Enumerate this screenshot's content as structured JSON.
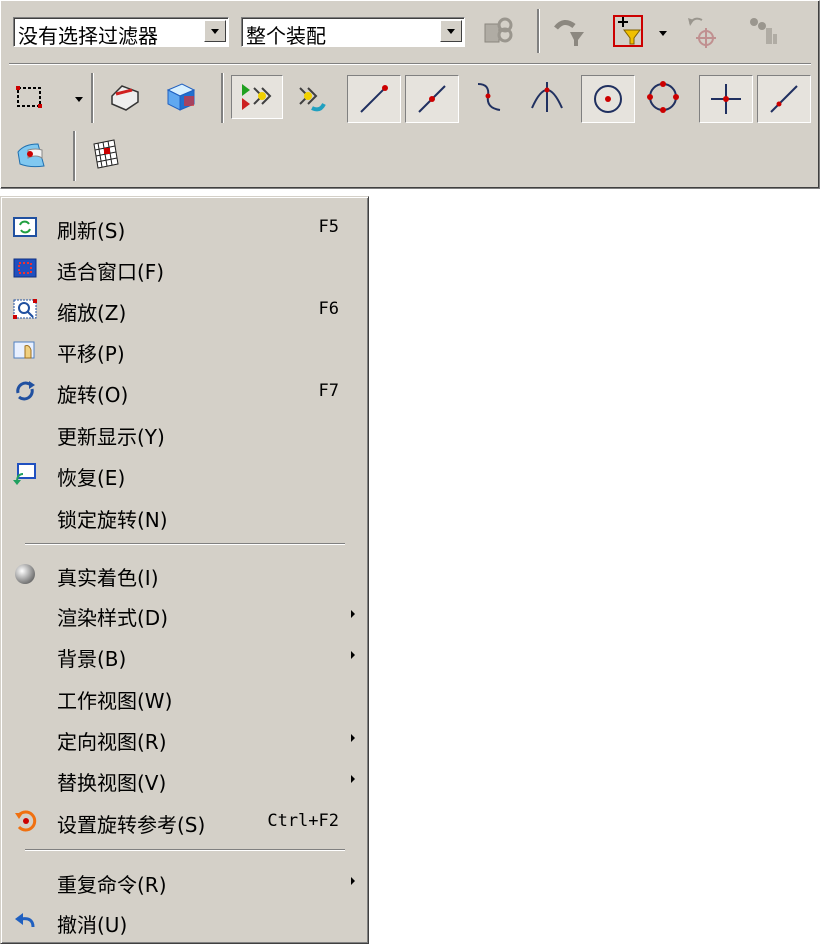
{
  "toolbar": {
    "filter_combo": {
      "value": "没有选择过滤器"
    },
    "scope_combo": {
      "value": "整个装配"
    },
    "row1_icons": [
      "assembly-constraint-icon",
      "undo-filter-icon",
      "select-filter-icon",
      "point-constructor-icon",
      "chain-icon"
    ],
    "row2_icons": [
      "rectangle-select-icon",
      "render-shade-icon",
      "cube-icon",
      "select-all-icon",
      "deselect-icon",
      "line-end-icon",
      "line-mid-icon",
      "curve-icon",
      "intersection-icon",
      "arc-center-icon",
      "quadrant-icon",
      "cross-point-icon",
      "point-on-curve-icon"
    ],
    "row3_icons": [
      "surface-icon",
      "grid-icon"
    ]
  },
  "menu": {
    "items": [
      {
        "label": "刷新(S)",
        "shortcut": "F5",
        "icon": "refresh-icon"
      },
      {
        "label": "适合窗口(F)",
        "shortcut": "",
        "icon": "fit-window-icon"
      },
      {
        "label": "缩放(Z)",
        "shortcut": "F6",
        "icon": "zoom-icon"
      },
      {
        "label": "平移(P)",
        "shortcut": "",
        "icon": "pan-icon"
      },
      {
        "label": "旋转(O)",
        "shortcut": "F7",
        "icon": "rotate-icon"
      },
      {
        "label": "更新显示(Y)",
        "shortcut": "",
        "icon": ""
      },
      {
        "label": "恢复(E)",
        "shortcut": "",
        "icon": "restore-icon"
      },
      {
        "label": "锁定旋转(N)",
        "shortcut": "",
        "icon": ""
      },
      {
        "label": "真实着色(I)",
        "shortcut": "",
        "icon": "true-shading-icon"
      },
      {
        "label": "渲染样式(D)",
        "shortcut": "",
        "icon": "",
        "submenu": true
      },
      {
        "label": "背景(B)",
        "shortcut": "",
        "icon": "",
        "submenu": true
      },
      {
        "label": "工作视图(W)",
        "shortcut": "",
        "icon": ""
      },
      {
        "label": "定向视图(R)",
        "shortcut": "",
        "icon": "",
        "submenu": true
      },
      {
        "label": "替换视图(V)",
        "shortcut": "",
        "icon": "",
        "submenu": true
      },
      {
        "label": "设置旋转参考(S)",
        "shortcut": "Ctrl+F2",
        "icon": "rotate-reference-icon"
      },
      {
        "label": "重复命令(R)",
        "shortcut": "",
        "icon": "",
        "submenu": true
      },
      {
        "label": "撤消(U)",
        "shortcut": "",
        "icon": "undo-icon"
      }
    ]
  }
}
